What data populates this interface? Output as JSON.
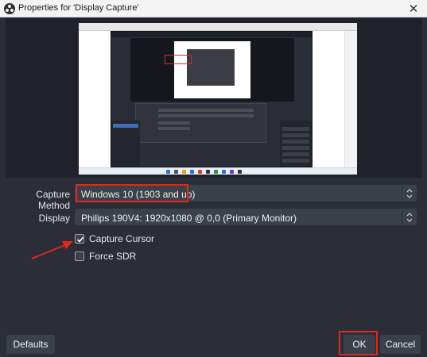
{
  "window": {
    "title": "Properties for 'Display Capture'",
    "close_glyph": "✕",
    "app_icon": "obs-logo-icon"
  },
  "preview": {
    "description_icon": "display-preview-image"
  },
  "form": {
    "capture_method": {
      "label": "Capture Method",
      "value": "Windows 10 (1903 and up)"
    },
    "display": {
      "label": "Display",
      "value": "Philips 190V4: 1920x1080 @ 0,0 (Primary Monitor)"
    },
    "capture_cursor": {
      "label": "Capture Cursor",
      "checked": true
    },
    "force_sdr": {
      "label": "Force SDR",
      "checked": false
    }
  },
  "buttons": {
    "defaults": "Defaults",
    "ok": "OK",
    "cancel": "Cancel"
  },
  "colors": {
    "background": "#2b2e38",
    "field": "#3c404b",
    "highlight": "#e0281f"
  }
}
